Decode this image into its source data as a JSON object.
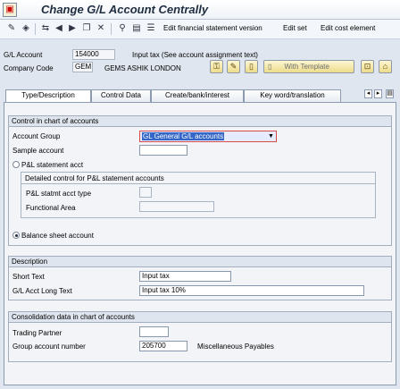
{
  "window": {
    "title": "Change G/L Account Centrally"
  },
  "toolbar": {
    "edit_fin_stmt": "Edit financial statement version",
    "edit_set": "Edit set",
    "edit_cost_element": "Edit cost element"
  },
  "header": {
    "gl_account_label": "G/L Account",
    "gl_account_value": "154000",
    "gl_account_desc": "Input tax (See account assignment text)",
    "company_code_label": "Company Code",
    "company_code_value": "GEM",
    "company_name": "GEMS ASHIK LONDON",
    "template_button": "With Template"
  },
  "tabs": [
    {
      "label": "Type/Description",
      "active": true
    },
    {
      "label": "Control Data",
      "active": false
    },
    {
      "label": "Create/bank/interest",
      "active": false
    },
    {
      "label": "Key word/translation",
      "active": false
    }
  ],
  "control_group": {
    "title": "Control in chart of accounts",
    "account_group_label": "Account Group",
    "account_group_value": "GL General G/L accounts",
    "sample_account_label": "Sample account",
    "sample_account_value": "",
    "pl_label": "P&L statement acct",
    "pl_selected": false,
    "detail_title": "Detailed control for P&L statement accounts",
    "pl_type_label": "P&L statmt acct type",
    "functional_area_label": "Functional Area",
    "balance_label": "Balance sheet account",
    "balance_selected": true
  },
  "description_group": {
    "title": "Description",
    "short_text_label": "Short Text",
    "short_text_value": "Input tax",
    "long_text_label": "G/L Acct Long Text",
    "long_text_value": "Input tax  10%"
  },
  "consolidation_group": {
    "title": "Consolidation data in chart of accounts",
    "trading_partner_label": "Trading Partner",
    "trading_partner_value": "",
    "group_account_label": "Group account number",
    "group_account_value": "205700",
    "group_account_desc": "Miscellaneous Payables"
  },
  "icons": {
    "title": "sap-app-icon",
    "colors": {
      "accent": "#3466c8",
      "panel": "#f2f4f7",
      "header": "#dfe5ee"
    }
  }
}
